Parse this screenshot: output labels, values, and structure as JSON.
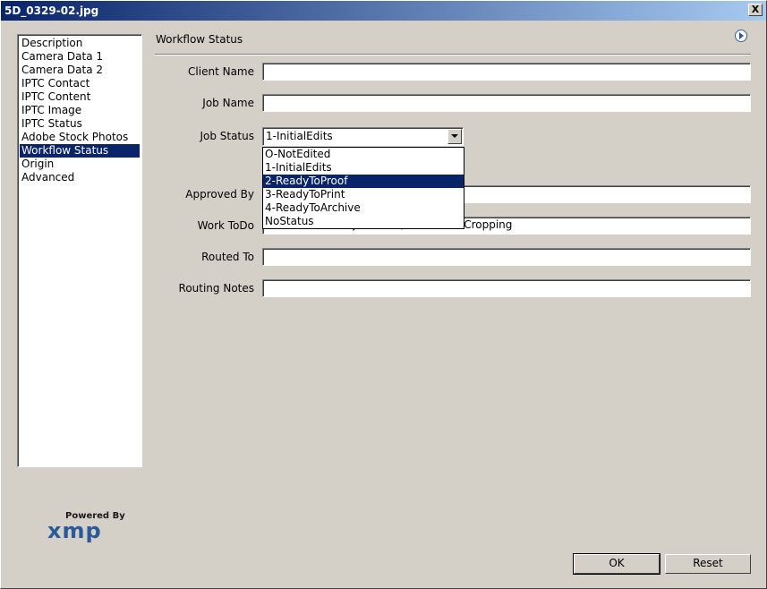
{
  "window": {
    "title": "5D_0329-02.jpg",
    "close_label": "X"
  },
  "sidebar": {
    "items": [
      {
        "label": "Description"
      },
      {
        "label": "Camera Data 1"
      },
      {
        "label": "Camera Data 2"
      },
      {
        "label": "IPTC Contact"
      },
      {
        "label": "IPTC Content"
      },
      {
        "label": "IPTC Image"
      },
      {
        "label": "IPTC Status"
      },
      {
        "label": "Adobe Stock Photos"
      },
      {
        "label": "Workflow Status",
        "selected": true
      },
      {
        "label": "Origin"
      },
      {
        "label": "Advanced"
      }
    ]
  },
  "panel": {
    "title": "Workflow Status",
    "fields": {
      "client_name": {
        "label": "Client Name",
        "value": ""
      },
      "job_name": {
        "label": "Job Name",
        "value": ""
      },
      "job_status": {
        "label": "Job Status",
        "value": "1-InitialEdits"
      },
      "approved_by": {
        "label": "Approved By",
        "value": ""
      },
      "work_todo": {
        "label": "Work ToDo",
        "value": "Micro Curves Adjustment, Advanced Cropping"
      },
      "routed_to": {
        "label": "Routed To",
        "value": ""
      },
      "routing_notes": {
        "label": "Routing Notes",
        "value": ""
      }
    },
    "job_status_options": [
      {
        "label": "O-NotEdited"
      },
      {
        "label": "1-InitialEdits"
      },
      {
        "label": "2-ReadyToProof",
        "highlighted": true
      },
      {
        "label": "3-ReadyToPrint"
      },
      {
        "label": "4-ReadyToArchive"
      },
      {
        "label": "NoStatus"
      }
    ]
  },
  "logo": {
    "powered": "Powered By",
    "brand": "xmp"
  },
  "buttons": {
    "ok": "OK",
    "reset": "Reset"
  },
  "colors": {
    "selection": "#0a246a",
    "dialog_bg": "#d4d0c8"
  }
}
